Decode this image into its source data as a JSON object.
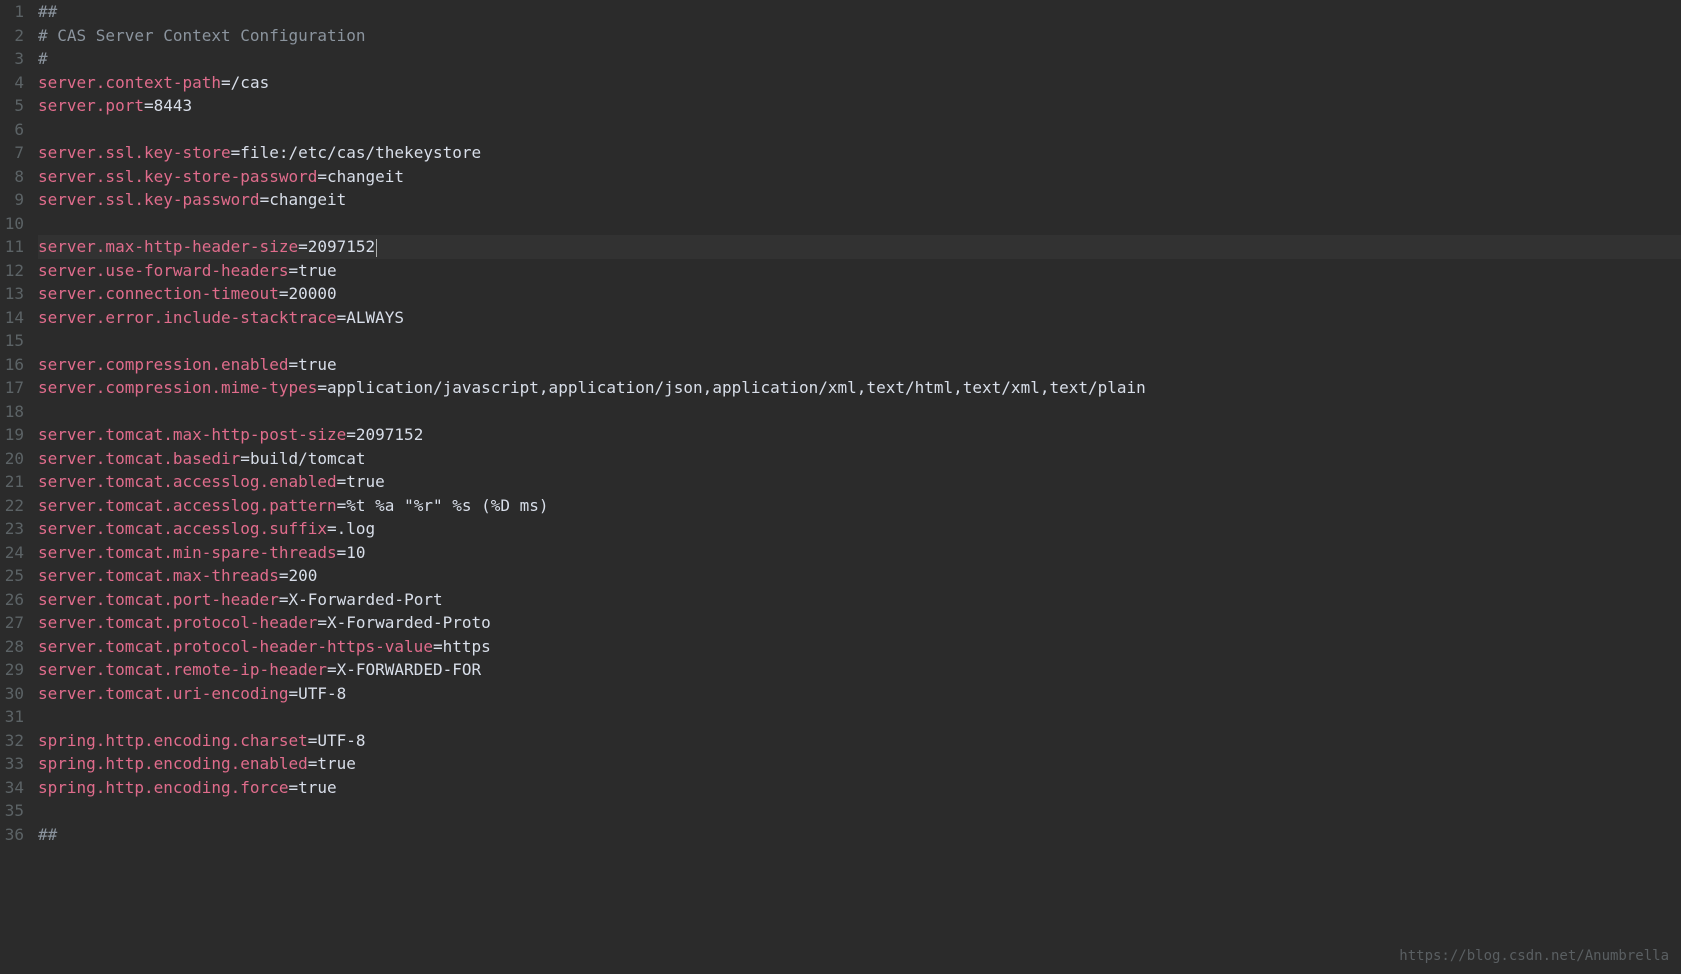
{
  "watermark": "https://blog.csdn.net/Anumbrella",
  "lines": [
    {
      "num": "1",
      "type": "comment",
      "text": "##"
    },
    {
      "num": "2",
      "type": "comment",
      "text": "# CAS Server Context Configuration"
    },
    {
      "num": "3",
      "type": "comment",
      "text": "#"
    },
    {
      "num": "4",
      "type": "kv",
      "key": "server.context-path",
      "val": "/cas"
    },
    {
      "num": "5",
      "type": "kv",
      "key": "server.port",
      "val": "8443"
    },
    {
      "num": "6",
      "type": "blank"
    },
    {
      "num": "7",
      "type": "kv",
      "key": "server.ssl.key-store",
      "val": "file:/etc/cas/thekeystore"
    },
    {
      "num": "8",
      "type": "kv",
      "key": "server.ssl.key-store-password",
      "val": "changeit"
    },
    {
      "num": "9",
      "type": "kv",
      "key": "server.ssl.key-password",
      "val": "changeit"
    },
    {
      "num": "10",
      "type": "blank"
    },
    {
      "num": "11",
      "type": "kv",
      "key": "server.max-http-header-size",
      "val": "2097152",
      "cursor": true,
      "hl": true
    },
    {
      "num": "12",
      "type": "kv",
      "key": "server.use-forward-headers",
      "val": "true"
    },
    {
      "num": "13",
      "type": "kv",
      "key": "server.connection-timeout",
      "val": "20000"
    },
    {
      "num": "14",
      "type": "kv",
      "key": "server.error.include-stacktrace",
      "val": "ALWAYS"
    },
    {
      "num": "15",
      "type": "blank"
    },
    {
      "num": "16",
      "type": "kv",
      "key": "server.compression.enabled",
      "val": "true"
    },
    {
      "num": "17",
      "type": "kv",
      "key": "server.compression.mime-types",
      "val": "application/javascript,application/json,application/xml,text/html,text/xml,text/plain"
    },
    {
      "num": "18",
      "type": "blank"
    },
    {
      "num": "19",
      "type": "kv",
      "key": "server.tomcat.max-http-post-size",
      "val": "2097152"
    },
    {
      "num": "20",
      "type": "kv",
      "key": "server.tomcat.basedir",
      "val": "build/tomcat"
    },
    {
      "num": "21",
      "type": "kv",
      "key": "server.tomcat.accesslog.enabled",
      "val": "true"
    },
    {
      "num": "22",
      "type": "kv",
      "key": "server.tomcat.accesslog.pattern",
      "val": "%t %a \"%r\" %s (%D ms)"
    },
    {
      "num": "23",
      "type": "kv",
      "key": "server.tomcat.accesslog.suffix",
      "val": ".log"
    },
    {
      "num": "24",
      "type": "kv",
      "key": "server.tomcat.min-spare-threads",
      "val": "10"
    },
    {
      "num": "25",
      "type": "kv",
      "key": "server.tomcat.max-threads",
      "val": "200"
    },
    {
      "num": "26",
      "type": "kv",
      "key": "server.tomcat.port-header",
      "val": "X-Forwarded-Port"
    },
    {
      "num": "27",
      "type": "kv",
      "key": "server.tomcat.protocol-header",
      "val": "X-Forwarded-Proto"
    },
    {
      "num": "28",
      "type": "kv",
      "key": "server.tomcat.protocol-header-https-value",
      "val": "https"
    },
    {
      "num": "29",
      "type": "kv",
      "key": "server.tomcat.remote-ip-header",
      "val": "X-FORWARDED-FOR"
    },
    {
      "num": "30",
      "type": "kv",
      "key": "server.tomcat.uri-encoding",
      "val": "UTF-8"
    },
    {
      "num": "31",
      "type": "blank"
    },
    {
      "num": "32",
      "type": "kv",
      "key": "spring.http.encoding.charset",
      "val": "UTF-8"
    },
    {
      "num": "33",
      "type": "kv",
      "key": "spring.http.encoding.enabled",
      "val": "true"
    },
    {
      "num": "34",
      "type": "kv",
      "key": "spring.http.encoding.force",
      "val": "true"
    },
    {
      "num": "35",
      "type": "blank"
    },
    {
      "num": "36",
      "type": "comment",
      "text": "##"
    }
  ]
}
